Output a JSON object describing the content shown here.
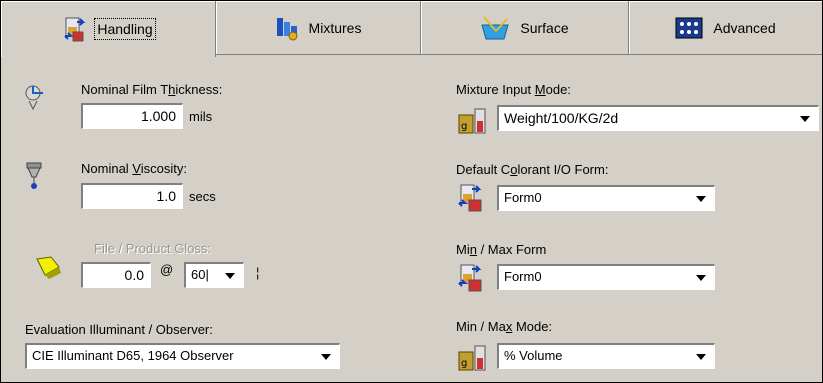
{
  "tabs": [
    {
      "label": "Handling",
      "icon": "beaker-arrows-icon",
      "active": true
    },
    {
      "label": "Mixtures",
      "icon": "mixtures-icon",
      "active": false
    },
    {
      "label": "Surface",
      "icon": "surface-icon",
      "active": false
    },
    {
      "label": "Advanced",
      "icon": "advanced-grid-icon",
      "active": false
    }
  ],
  "film": {
    "label_pre": "Nominal Film T",
    "label_u": "h",
    "label_post": "ickness:",
    "value": "1.000",
    "unit": "mils"
  },
  "viscosity": {
    "label_pre": "Nominal ",
    "label_u": "V",
    "label_post": "iscosity:",
    "value": "1.0",
    "unit": "secs"
  },
  "gloss": {
    "label": "File / Product Gloss:",
    "value": "0.0",
    "at": "@",
    "angle": "60|",
    "tail": "¦"
  },
  "illuminant": {
    "label": "Evaluation Illuminant / Observer:",
    "value": "CIE Illuminant D65, 1964 Observer"
  },
  "mixture_mode": {
    "label_pre": "Mixture Input ",
    "label_u": "M",
    "label_post": "ode:",
    "value": "Weight/100/KG/2d"
  },
  "colorant_form": {
    "label_pre": "Default C",
    "label_u": "o",
    "label_post": "lorant I/O Form:",
    "value": "Form0"
  },
  "minmax_form": {
    "label_pre": "Mi",
    "label_u": "n",
    "label_post": " / Max Form",
    "value": "Form0"
  },
  "minmax_mode": {
    "label_pre": "Min / Ma",
    "label_u": "x",
    "label_post": " Mode:",
    "value": "% Volume"
  }
}
